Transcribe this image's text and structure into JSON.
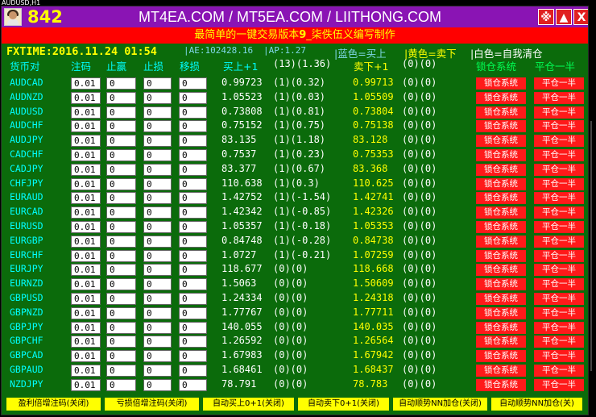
{
  "chart_tab": "AUDUSD,H1",
  "window": {
    "number": "842",
    "title": "MT4EA.COM / MT5EA.COM / LIITHONG.COM",
    "btn_settings": "※",
    "btn_up": "▲",
    "btn_close": "X",
    "subtitle_pre": "最简单的一键交易版本",
    "subtitle_ver": "9",
    "subtitle_post": "_柒佚伍义编写制作"
  },
  "info": {
    "fxtime": "FXTIME:2016.11.24 01:54",
    "ae": "|AE:102428.16",
    "ap": "|AP:1.27",
    "legend_blue": "|蓝色=买上",
    "legend_yellow": "|黄色=卖下",
    "legend_white": "|白色=自我清仓"
  },
  "headers": {
    "symbol": "货币对",
    "lots": "注码",
    "tp": "止赢",
    "sl": "止损",
    "trail": "移损",
    "buy": "买上+1",
    "buy_stats": "(13)(1.36)",
    "sell": "卖下+1",
    "sell_stats": "(0)(0)",
    "lock": "锁仓系统",
    "close_half": "平仓一半"
  },
  "rows": [
    {
      "symbol": "AUDCAD",
      "lots": "0.01",
      "tp": "0",
      "sl": "0",
      "trail": "0",
      "bid": "0.99723",
      "bid_stats": "(1)(0.32)",
      "ask": "0.99713",
      "ask_stats": "(0)(0)",
      "lock": "锁仓系统",
      "half": "平仓一半"
    },
    {
      "symbol": "AUDNZD",
      "lots": "0.01",
      "tp": "0",
      "sl": "0",
      "trail": "0",
      "bid": "1.05523",
      "bid_stats": "(1)(0.03)",
      "ask": "1.05509",
      "ask_stats": "(0)(0)",
      "lock": "锁仓系统",
      "half": "平仓一半"
    },
    {
      "symbol": "AUDUSD",
      "lots": "0.01",
      "tp": "0",
      "sl": "0",
      "trail": "0",
      "bid": "0.73808",
      "bid_stats": "(1)(0.81)",
      "ask": "0.73804",
      "ask_stats": "(0)(0)",
      "lock": "锁仓系统",
      "half": "平仓一半"
    },
    {
      "symbol": "AUDCHF",
      "lots": "0.01",
      "tp": "0",
      "sl": "0",
      "trail": "0",
      "bid": "0.75152",
      "bid_stats": "(1)(0.75)",
      "ask": "0.75138",
      "ask_stats": "(0)(0)",
      "lock": "锁仓系统",
      "half": "平仓一半"
    },
    {
      "symbol": "AUDJPY",
      "lots": "0.01",
      "tp": "0",
      "sl": "0",
      "trail": "0",
      "bid": "83.135",
      "bid_stats": "(1)(1.18)",
      "ask": "83.128",
      "ask_stats": "(0)(0)",
      "lock": "锁仓系统",
      "half": "平仓一半"
    },
    {
      "symbol": "CADCHF",
      "lots": "0.01",
      "tp": "0",
      "sl": "0",
      "trail": "0",
      "bid": "0.7537",
      "bid_stats": "(1)(0.23)",
      "ask": "0.75353",
      "ask_stats": "(0)(0)",
      "lock": "锁仓系统",
      "half": "平仓一半"
    },
    {
      "symbol": "CADJPY",
      "lots": "0.01",
      "tp": "0",
      "sl": "0",
      "trail": "0",
      "bid": "83.377",
      "bid_stats": "(1)(0.67)",
      "ask": "83.368",
      "ask_stats": "(0)(0)",
      "lock": "锁仓系统",
      "half": "平仓一半"
    },
    {
      "symbol": "CHFJPY",
      "lots": "0.01",
      "tp": "0",
      "sl": "0",
      "trail": "0",
      "bid": "110.638",
      "bid_stats": "(1)(0.3)",
      "ask": "110.625",
      "ask_stats": "(0)(0)",
      "lock": "锁仓系统",
      "half": "平仓一半"
    },
    {
      "symbol": "EURAUD",
      "lots": "0.01",
      "tp": "0",
      "sl": "0",
      "trail": "0",
      "bid": "1.42752",
      "bid_stats": "(1)(-1.54)",
      "ask": "1.42741",
      "ask_stats": "(0)(0)",
      "lock": "锁仓系统",
      "half": "平仓一半"
    },
    {
      "symbol": "EURCAD",
      "lots": "0.01",
      "tp": "0",
      "sl": "0",
      "trail": "0",
      "bid": "1.42342",
      "bid_stats": "(1)(-0.85)",
      "ask": "1.42326",
      "ask_stats": "(0)(0)",
      "lock": "锁仓系统",
      "half": "平仓一半"
    },
    {
      "symbol": "EURUSD",
      "lots": "0.01",
      "tp": "0",
      "sl": "0",
      "trail": "0",
      "bid": "1.05357",
      "bid_stats": "(1)(-0.18)",
      "ask": "1.05353",
      "ask_stats": "(0)(0)",
      "lock": "锁仓系统",
      "half": "平仓一半"
    },
    {
      "symbol": "EURGBP",
      "lots": "0.01",
      "tp": "0",
      "sl": "0",
      "trail": "0",
      "bid": "0.84748",
      "bid_stats": "(1)(-0.28)",
      "ask": "0.84738",
      "ask_stats": "(0)(0)",
      "lock": "锁仓系统",
      "half": "平仓一半"
    },
    {
      "symbol": "EURCHF",
      "lots": "0.01",
      "tp": "0",
      "sl": "0",
      "trail": "0",
      "bid": "1.0727",
      "bid_stats": "(1)(-0.21)",
      "ask": "1.07259",
      "ask_stats": "(0)(0)",
      "lock": "锁仓系统",
      "half": "平仓一半"
    },
    {
      "symbol": "EURJPY",
      "lots": "0.01",
      "tp": "0",
      "sl": "0",
      "trail": "0",
      "bid": "118.677",
      "bid_stats": "(0)(0)",
      "ask": "118.668",
      "ask_stats": "(0)(0)",
      "lock": "锁仓系统",
      "half": "平仓一半"
    },
    {
      "symbol": "EURNZD",
      "lots": "0.01",
      "tp": "0",
      "sl": "0",
      "trail": "0",
      "bid": "1.5063",
      "bid_stats": "(0)(0)",
      "ask": "1.50609",
      "ask_stats": "(0)(0)",
      "lock": "锁仓系统",
      "half": "平仓一半"
    },
    {
      "symbol": "GBPUSD",
      "lots": "0.01",
      "tp": "0",
      "sl": "0",
      "trail": "0",
      "bid": "1.24334",
      "bid_stats": "(0)(0)",
      "ask": "1.24318",
      "ask_stats": "(0)(0)",
      "lock": "锁仓系统",
      "half": "平仓一半"
    },
    {
      "symbol": "GBPNZD",
      "lots": "0.01",
      "tp": "0",
      "sl": "0",
      "trail": "0",
      "bid": "1.77767",
      "bid_stats": "(0)(0)",
      "ask": "1.77711",
      "ask_stats": "(0)(0)",
      "lock": "锁仓系统",
      "half": "平仓一半"
    },
    {
      "symbol": "GBPJPY",
      "lots": "0.01",
      "tp": "0",
      "sl": "0",
      "trail": "0",
      "bid": "140.055",
      "bid_stats": "(0)(0)",
      "ask": "140.035",
      "ask_stats": "(0)(0)",
      "lock": "锁仓系统",
      "half": "平仓一半"
    },
    {
      "symbol": "GBPCHF",
      "lots": "0.01",
      "tp": "0",
      "sl": "0",
      "trail": "0",
      "bid": "1.26592",
      "bid_stats": "(0)(0)",
      "ask": "1.26564",
      "ask_stats": "(0)(0)",
      "lock": "锁仓系统",
      "half": "平仓一半"
    },
    {
      "symbol": "GBPCAD",
      "lots": "0.01",
      "tp": "0",
      "sl": "0",
      "trail": "0",
      "bid": "1.67983",
      "bid_stats": "(0)(0)",
      "ask": "1.67942",
      "ask_stats": "(0)(0)",
      "lock": "锁仓系统",
      "half": "平仓一半"
    },
    {
      "symbol": "GBPAUD",
      "lots": "0.01",
      "tp": "0",
      "sl": "0",
      "trail": "0",
      "bid": "1.68461",
      "bid_stats": "(0)(0)",
      "ask": "1.68437",
      "ask_stats": "(0)(0)",
      "lock": "锁仓系统",
      "half": "平仓一半"
    },
    {
      "symbol": "NZDJPY",
      "lots": "0.01",
      "tp": "0",
      "sl": "0",
      "trail": "0",
      "bid": "78.791",
      "bid_stats": "(0)(0)",
      "ask": "78.783",
      "ask_stats": "(0)(0)",
      "lock": "锁仓系统",
      "half": "平仓一半"
    }
  ],
  "bottom_buttons": [
    "盈利倍增注码(关闭)",
    "亏损倍增注码(关闭)",
    "自动买上0+1(关闭)",
    "自动卖下0+1(关闭)",
    "自动顺势NN加仓(关闭)",
    "自动顺势NN加仓(关)"
  ],
  "colors": {
    "panel_bg": "#0b6b0b",
    "title_bg": "#8a14b4",
    "subtitle_bg": "#ff0000",
    "accent_yellow": "#ffff00",
    "symbol_cyan": "#00ffff",
    "button_red": "#ff1a1a"
  },
  "icons": {
    "logo": "avatar-logo-icon",
    "settings": "reference-mark-icon",
    "minimize": "triangle-up-icon",
    "close": "close-x-icon"
  }
}
